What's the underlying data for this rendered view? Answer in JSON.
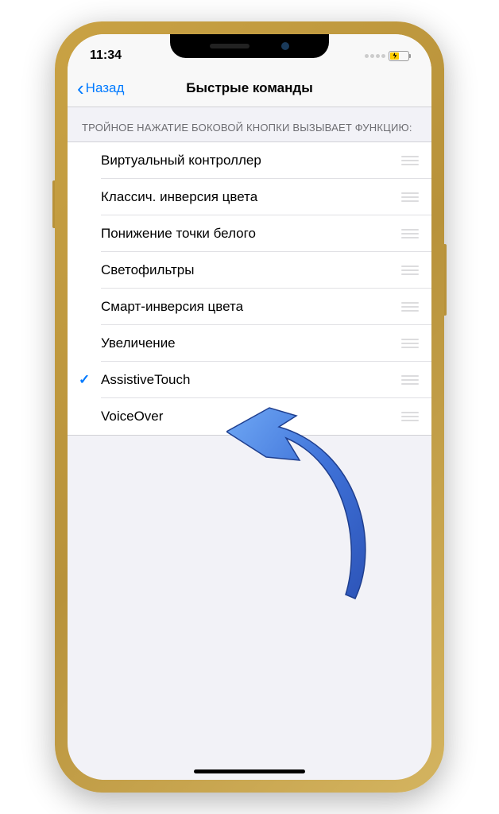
{
  "status": {
    "time": "11:34"
  },
  "nav": {
    "back": "Назад",
    "title": "Быстрые команды"
  },
  "section": {
    "header": "ТРОЙНОЕ НАЖАТИЕ БОКОВОЙ КНОПКИ ВЫЗЫВАЕТ ФУНКЦИЮ:"
  },
  "items": [
    {
      "label": "Виртуальный контроллер",
      "checked": false
    },
    {
      "label": "Классич. инверсия цвета",
      "checked": false
    },
    {
      "label": "Понижение точки белого",
      "checked": false
    },
    {
      "label": "Светофильтры",
      "checked": false
    },
    {
      "label": "Смарт-инверсия цвета",
      "checked": false
    },
    {
      "label": "Увеличение",
      "checked": false
    },
    {
      "label": "AssistiveTouch",
      "checked": true
    },
    {
      "label": "VoiceOver",
      "checked": false
    }
  ]
}
